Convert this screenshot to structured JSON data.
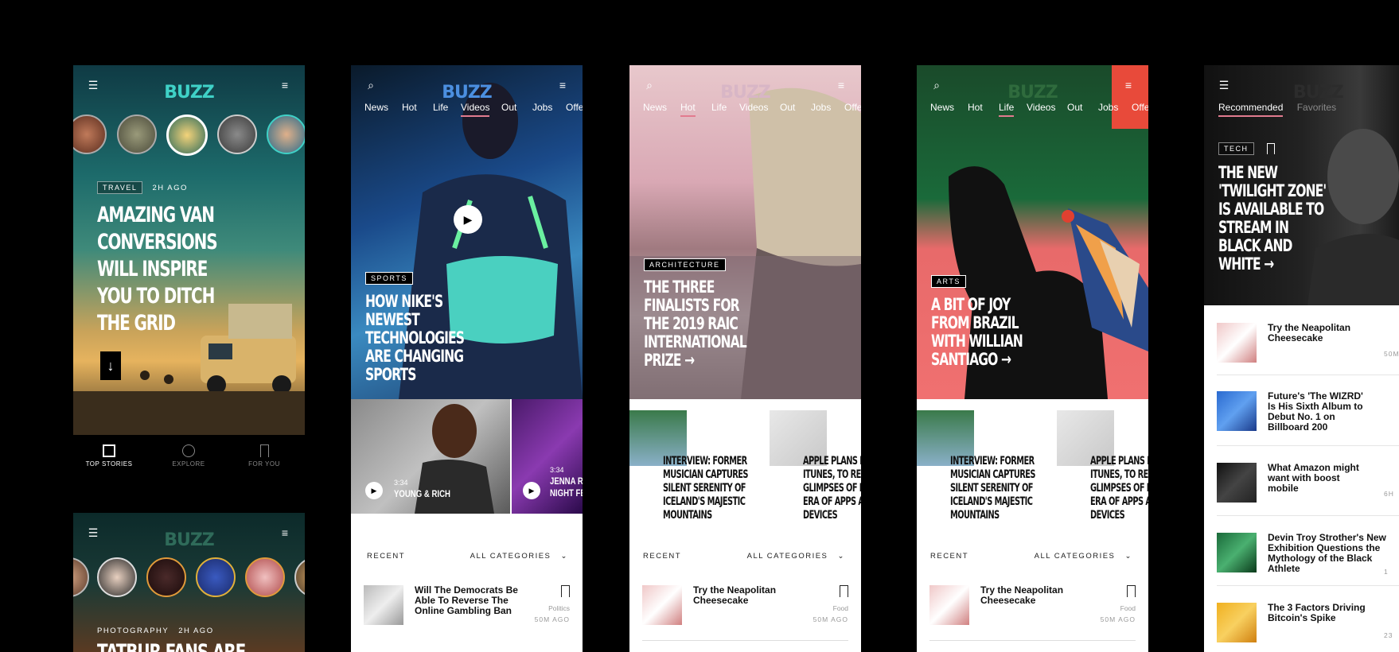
{
  "brand": "BUZZ",
  "colors": {
    "logo_teal": "#3fd1c7",
    "logo_blue": "#4b8fe0",
    "logo_pink": "#d8b6c6",
    "logo_green": "#2f6b3d",
    "logo_dark": "#2c2c2c",
    "accent_underline": "#e27b8f"
  },
  "nav_tabs": [
    "News",
    "Hot",
    "Life",
    "Videos",
    "Out",
    "Jobs",
    "Offe"
  ],
  "screen1": {
    "tag": "TRAVEL",
    "time": "2H AGO",
    "headline": [
      "AMAZING VAN",
      "CONVERSIONS",
      "WILL INSPIRE",
      "YOU TO DITCH",
      "THE GRID"
    ],
    "bottom_nav": [
      "TOP STORIES",
      "EXPLORE",
      "FOR YOU"
    ]
  },
  "screen1b": {
    "tag": "PHOTOGRAPHY",
    "time": "2H AGO",
    "headline": "TATBUR FANS ARE"
  },
  "screen2": {
    "active_tab": "Videos",
    "tag": "SPORTS",
    "headline": [
      "HOW NIKE'S",
      "NEWEST",
      "TECHNOLOGIES",
      "ARE CHANGING",
      "SPORTS"
    ],
    "video1": {
      "duration": "3:34",
      "title": "YOUNG & RICH"
    },
    "video2": {
      "duration": "3:34",
      "title": "JENNA R",
      "title2": "NIGHT FE"
    },
    "recent": "RECENT",
    "categories": "ALL CATEGORIES",
    "item": {
      "title": "Will The Democrats Be Able To Reverse The Online Gambling Ban",
      "category": "Politics",
      "time": "50M AGO"
    }
  },
  "screen3": {
    "active_tab": "Hot",
    "tag": "ARCHITECTURE",
    "headline": [
      "THE THREE",
      "FINALISTS FOR",
      "THE 2019 RAIC",
      "INTERNATIONAL",
      "PRIZE"
    ],
    "card1": [
      "INTERVIEW: FORMER",
      "MUSICIAN CAPTURES",
      "SILENT SERENITY OF",
      "ICELAND'S MAJESTIC",
      "MOUNTAINS"
    ],
    "card2": [
      "APPLE PLANS E",
      "ITUNES, TO REV",
      "GLIMPSES OF I",
      "ERA OF APPS A",
      "DEVICES"
    ],
    "recent": "RECENT",
    "categories": "ALL CATEGORIES",
    "item": {
      "title": "Try the Neapolitan Cheesecake",
      "category": "Food",
      "time": "50M AGO"
    }
  },
  "screen4": {
    "active_tab": "Life",
    "tag": "ARTS",
    "headline": [
      "A BIT OF JOY",
      "FROM BRAZIL",
      "WITH WILLIAN",
      "SANTIAGO"
    ],
    "card1": [
      "INTERVIEW: FORMER",
      "MUSICIAN CAPTURES",
      "SILENT SERENITY OF",
      "ICELAND'S MAJESTIC",
      "MOUNTAINS"
    ],
    "card2": [
      "APPLE PLANS E",
      "ITUNES, TO REV",
      "GLIMPSES OF I",
      "ERA OF APPS A",
      "DEVICES"
    ],
    "recent": "RECENT",
    "categories": "ALL CATEGORIES",
    "item": {
      "title": "Try the Neapolitan Cheesecake",
      "category": "Food",
      "time": "50M AGO"
    }
  },
  "screen5": {
    "tabs": [
      "Recommended",
      "Favorites"
    ],
    "tag": "TECH",
    "headline": [
      "THE NEW",
      "'TWILIGHT ZONE'",
      "IS AVAILABLE TO",
      "STREAM IN",
      "BLACK AND",
      "WHITE"
    ],
    "items": [
      {
        "title": "Try the Neapolitan Cheesecake",
        "time": "50M"
      },
      {
        "title": "Future's 'The WIZRD' Is His Sixth Album to Debut No. 1 on Billboard 200",
        "time": ""
      },
      {
        "title": "What Amazon might want with boost mobile",
        "time": "6H"
      },
      {
        "title": "Devin Troy Strother's New Exhibition Questions the Mythology of the Black Athlete",
        "time": "1"
      },
      {
        "title": "The 3 Factors Driving Bitcoin's Spike",
        "time": "23"
      }
    ]
  }
}
